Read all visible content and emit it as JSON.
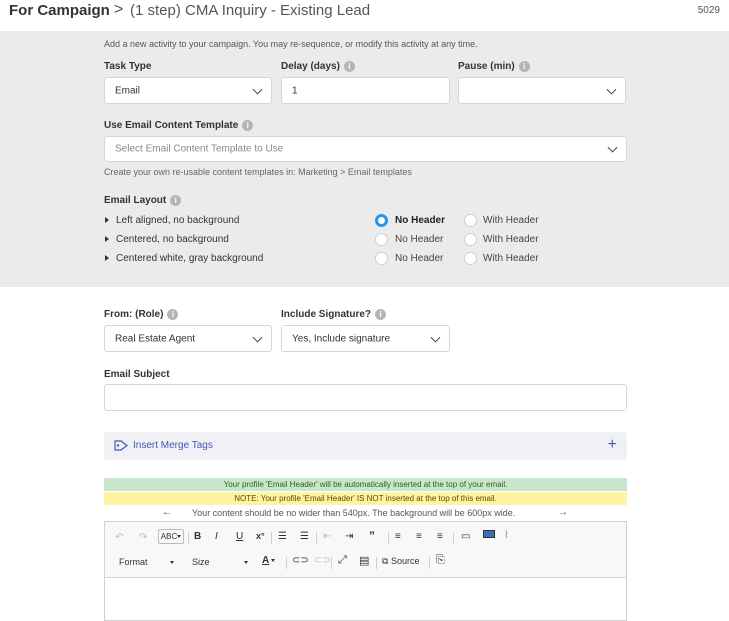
{
  "header": {
    "title": "For Campaign",
    "separator": ">",
    "subtitle": "(1 step) CMA Inquiry - Existing Lead",
    "id": "5029"
  },
  "intro": "Add a new activity to your campaign. You may re-sequence, or modify this activity at any time.",
  "task_type": {
    "label": "Task Type",
    "value": "Email"
  },
  "delay": {
    "label": "Delay (days)",
    "value": "1"
  },
  "pause": {
    "label": "Pause (min)",
    "value": ""
  },
  "template": {
    "label": "Use Email Content Template",
    "placeholder": "Select Email Content Template to Use",
    "help": "Create your own re-usable content templates in: Marketing > Email templates"
  },
  "email_layout": {
    "label": "Email Layout",
    "rows": [
      {
        "label": "Left aligned, no background",
        "no_header": "No Header",
        "with_header": "With Header",
        "selected": "no_header"
      },
      {
        "label": "Centered, no background",
        "no_header": "No Header",
        "with_header": "With Header",
        "selected": ""
      },
      {
        "label": "Centered white, gray background",
        "no_header": "No Header",
        "with_header": "With Header",
        "selected": ""
      }
    ]
  },
  "from": {
    "label": "From: (Role)",
    "value": "Real Estate Agent"
  },
  "signature": {
    "label": "Include Signature?",
    "value": "Yes, Include signature"
  },
  "subject": {
    "label": "Email Subject",
    "value": ""
  },
  "merge_tags": {
    "label": "Insert Merge Tags",
    "plus": "+"
  },
  "notices": {
    "green": "Your profile 'Email Header' will be automatically inserted at the top of your email.",
    "yellow": "NOTE: Your profile 'Email Header' IS NOT inserted at the top of this email.",
    "width": "Your content should be no wider than 540px. The background will be 600px wide.",
    "left_arrow": "←",
    "right_arrow": "→"
  },
  "toolbar": {
    "format": "Format",
    "size": "Size",
    "source": "Source",
    "bold": "B",
    "italic": "I",
    "underline": "U"
  },
  "colors": {
    "accent": "#2196f3",
    "link": "#3b5bb5",
    "panel": "#ebebeb",
    "green_notice": "#c8e6c9",
    "yellow_notice": "#fff4a3"
  }
}
